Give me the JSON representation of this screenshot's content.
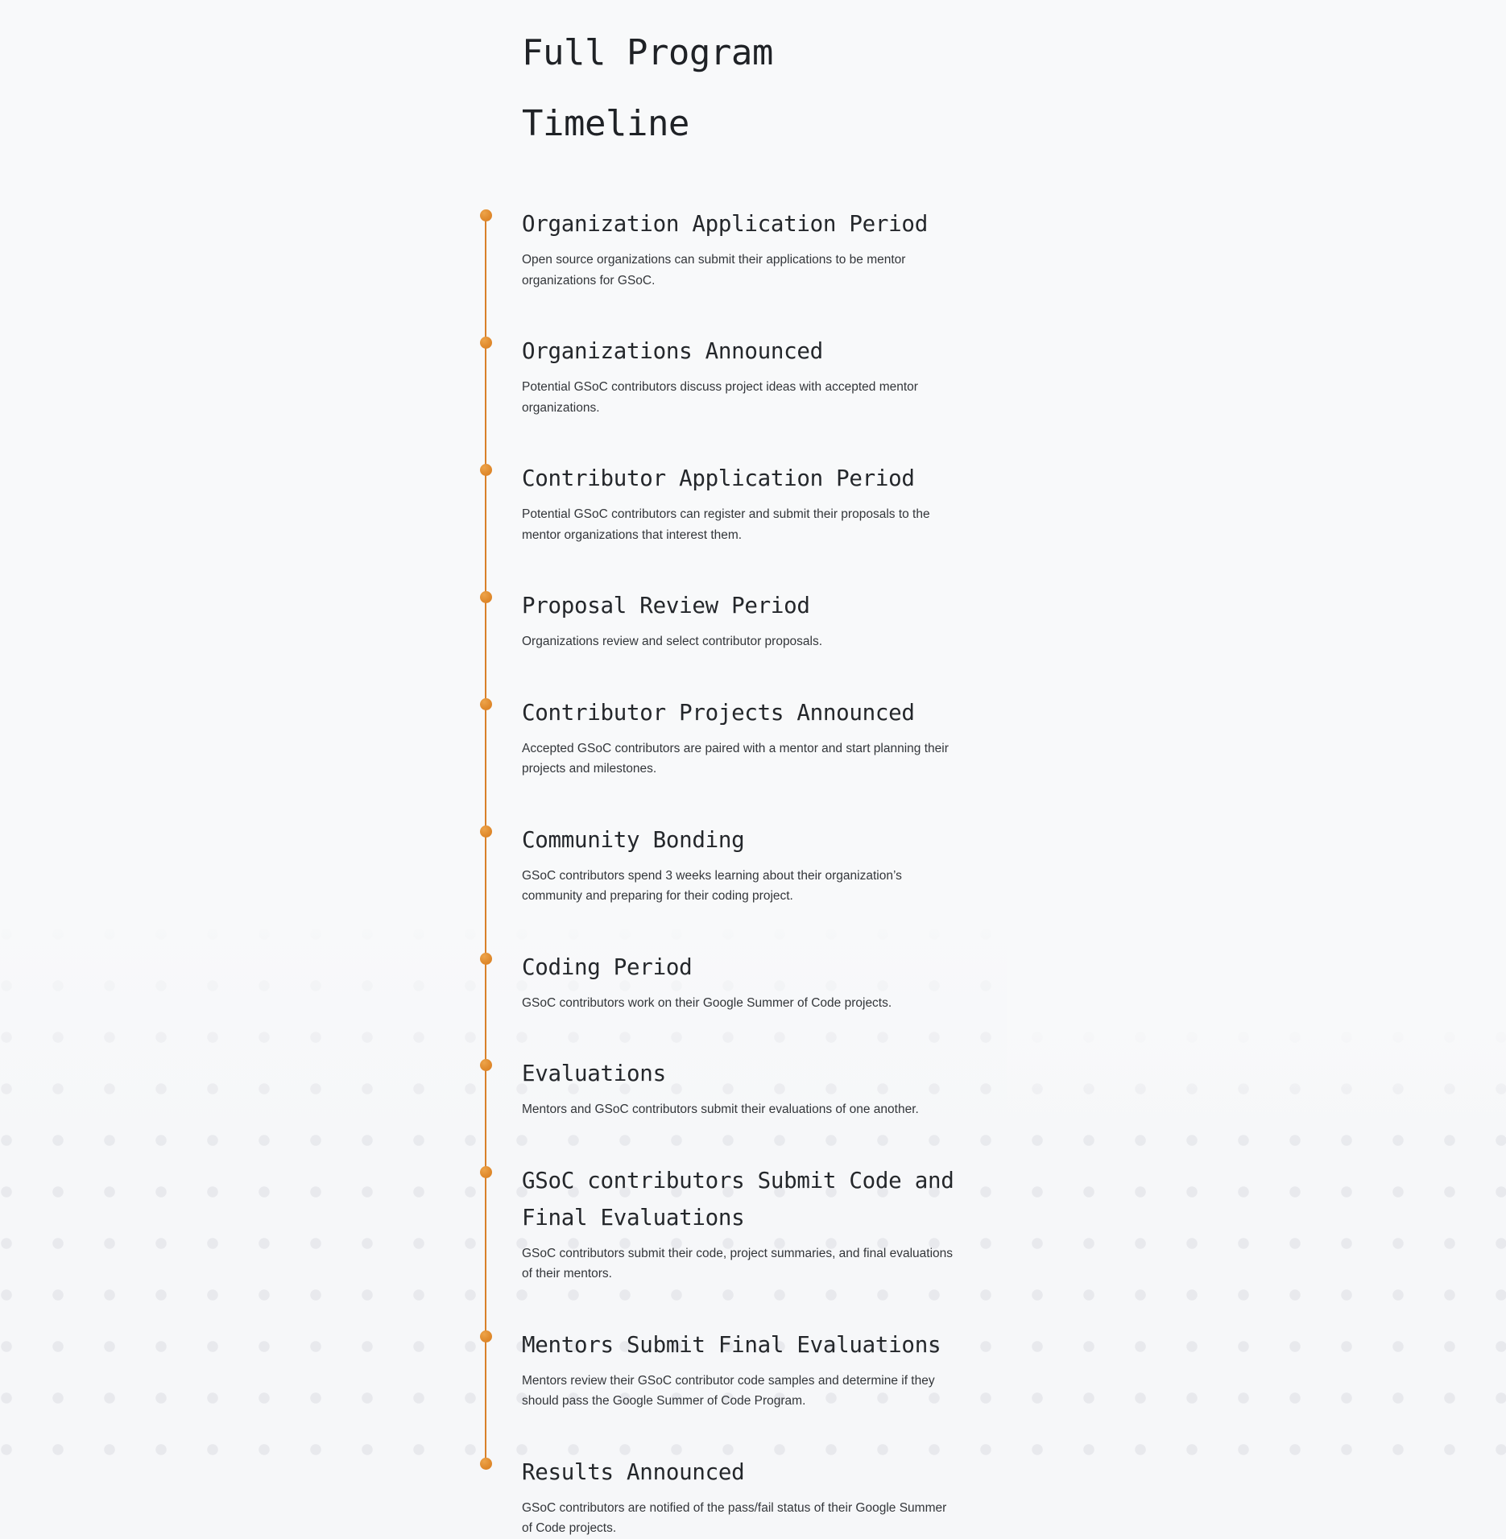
{
  "page": {
    "title": "Full Program\nTimeline",
    "background_color": "#f6f7f9",
    "dot_color": "#e8e9ed",
    "accent_color": "#e08b2e"
  },
  "timeline": {
    "rail_color": "#d9812a",
    "marker_icon": "timeline-dot-icon",
    "items": [
      {
        "title": "Organization Application Period",
        "description": "Open source organizations can submit their applications to be mentor organizations for GSoC."
      },
      {
        "title": "Organizations Announced",
        "description": "Potential GSoC contributors discuss project ideas with accepted mentor organizations."
      },
      {
        "title": "Contributor Application Period",
        "description": "Potential GSoC contributors can register and submit their proposals to the mentor organizations that interest them."
      },
      {
        "title": "Proposal Review Period",
        "description": "Organizations review and select contributor proposals."
      },
      {
        "title": "Contributor Projects Announced",
        "description": "Accepted GSoC contributors are paired with a mentor and start planning their projects and milestones."
      },
      {
        "title": "Community Bonding",
        "description": "GSoC contributors spend 3 weeks learning about their organization’s community and preparing for their coding project."
      },
      {
        "title": "Coding Period",
        "description": "GSoC contributors work on their Google Summer of Code projects."
      },
      {
        "title": "Evaluations",
        "description": "Mentors and GSoC contributors submit their evaluations of one another."
      },
      {
        "title": "GSoC contributors Submit Code and Final Evaluations",
        "description": "GSoC contributors submit their code, project summaries, and final evaluations of their mentors."
      },
      {
        "title": "Mentors Submit Final Evaluations",
        "description": "Mentors review their GSoC contributor code samples and determine if they should pass the Google Summer of Code Program."
      },
      {
        "title": "Results Announced",
        "description": "GSoC contributors are notified of the pass/fail status of their Google Summer of Code projects."
      }
    ]
  }
}
